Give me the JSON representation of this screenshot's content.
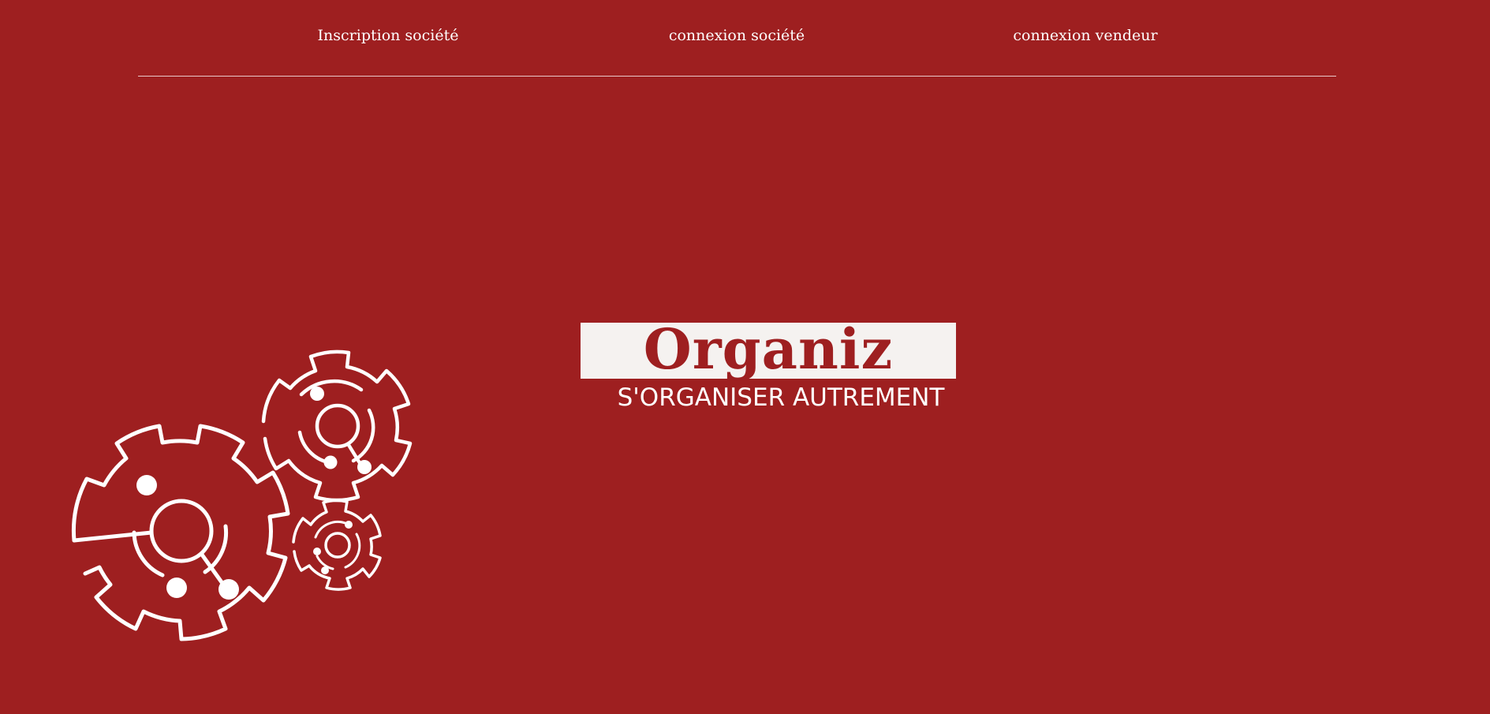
{
  "nav": {
    "links": [
      {
        "label": "Inscription société"
      },
      {
        "label": "connexion société"
      },
      {
        "label": "connexion vendeur"
      }
    ]
  },
  "logo": {
    "title": "Organiz",
    "tagline": "S'ORGANISER AUTREMENT"
  },
  "illustration": {
    "icon": "gears-icon"
  },
  "colors": {
    "background": "#9e1f20",
    "logo_box": "#f5f2f0",
    "text": "#ffffff"
  }
}
